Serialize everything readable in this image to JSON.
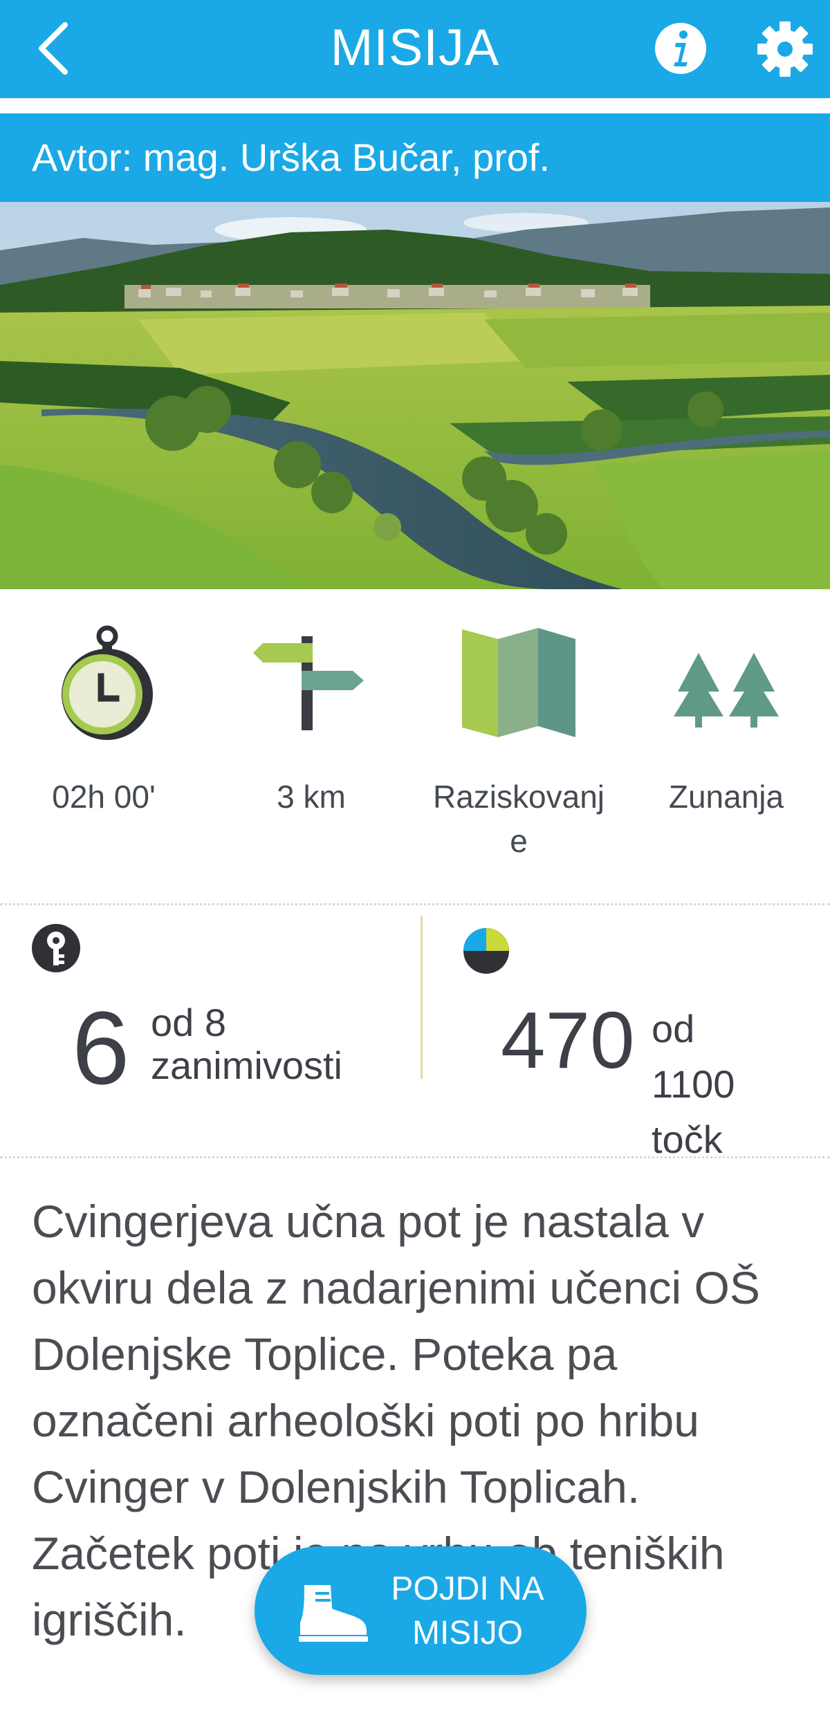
{
  "appbar": {
    "title": "MISIJA",
    "back_icon": "chevron-left-icon",
    "info_icon": "info-icon",
    "settings_icon": "gear-icon",
    "color": "#1aa9e6"
  },
  "author": {
    "text": "Avtor: mag. Urška Bučar, prof."
  },
  "hero": {
    "image": "landscape-photo"
  },
  "stats": [
    {
      "icon": "stopwatch-icon",
      "label": "02h 00'"
    },
    {
      "icon": "signpost-icon",
      "label": "3 km"
    },
    {
      "icon": "map-icon",
      "label": "Raziskovanje"
    },
    {
      "icon": "trees-icon",
      "label": "Zunanja"
    }
  ],
  "progress": {
    "found": {
      "icon": "key-icon",
      "value": "6",
      "of_text": "od 8 zanimivosti"
    },
    "points": {
      "icon": "pie-chart-icon",
      "value": "470",
      "of_text": "od 1100 točk"
    }
  },
  "description": "Cvingerjeva učna pot je nastala v okviru dela z nadarjenimi učenci OŠ Dolenjske Toplice. Poteka pa označeni arheološki poti po hribu Cvinger v Dolenjskih Toplicah. Začetek poti je na vrhu ob teniških igriščih.",
  "cta": {
    "icon": "hiking-boot-icon",
    "label": "POJDI NA MISIJO"
  }
}
